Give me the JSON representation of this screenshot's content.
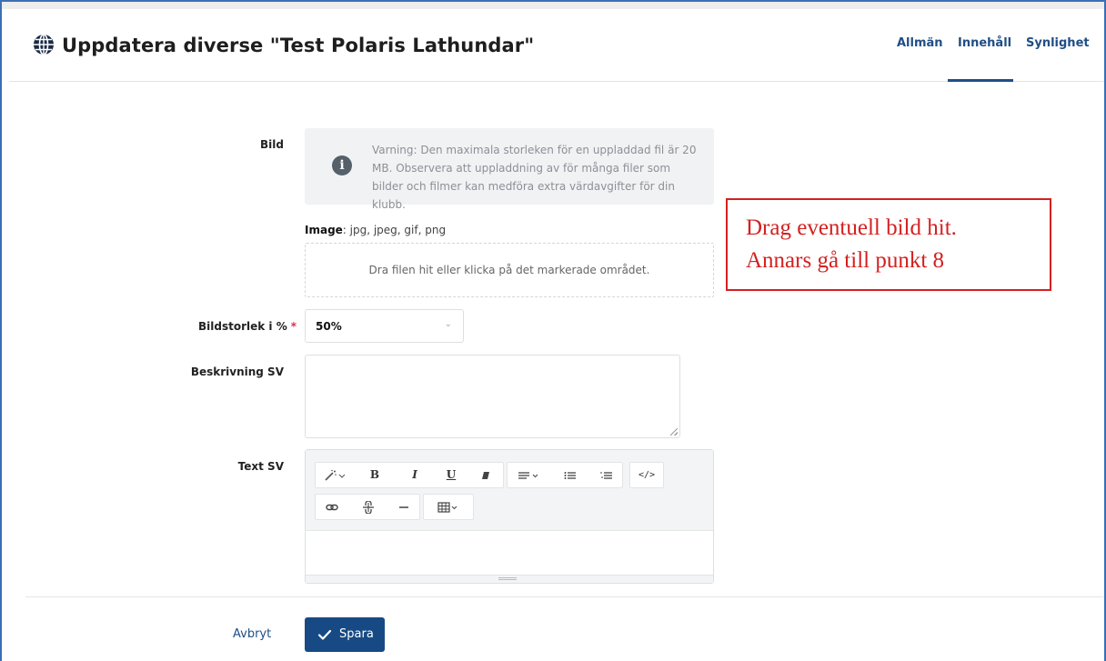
{
  "header": {
    "title": "Uppdatera diverse \"Test Polaris Lathundar\"",
    "tabs": [
      {
        "label": "Allmän",
        "active": false
      },
      {
        "label": "Innehåll",
        "active": true
      },
      {
        "label": "Synlighet",
        "active": false
      }
    ]
  },
  "form": {
    "bild_label": "Bild",
    "warning_text": "Varning: Den maximala storleken för en uppladdad fil är 20 MB. Observera att uppladdning av för många filer som bilder och filmer kan medföra extra värdavgifter för din klubb.",
    "image_label": "Image",
    "image_types": ": jpg, jpeg, gif, png",
    "dropzone_text": "Dra filen hit eller klicka på det markerade området.",
    "size_label": "Bildstorlek i %",
    "size_required": "*",
    "size_value": "50%",
    "description_label": "Beskrivning SV",
    "description_value": "",
    "text_label": "Text SV",
    "text_value": ""
  },
  "toolbar_icons": [
    "magic-wand-icon",
    "bold-icon",
    "italic-icon",
    "underline-icon",
    "eraser-icon",
    "align-icon",
    "unordered-list-icon",
    "ordered-list-icon",
    "code-view-icon",
    "link-icon",
    "unlink-icon",
    "horizontal-rule-icon",
    "table-icon"
  ],
  "actions": {
    "cancel_label": "Avbryt",
    "save_label": "Spara"
  },
  "annotation": {
    "line1": "Drag eventuell bild hit.",
    "line2": "Annars gå till punkt 8"
  },
  "colors": {
    "accent": "#174a84",
    "tab_text": "#1f4e86",
    "annotation": "#d42020",
    "required": "#d0364b"
  }
}
